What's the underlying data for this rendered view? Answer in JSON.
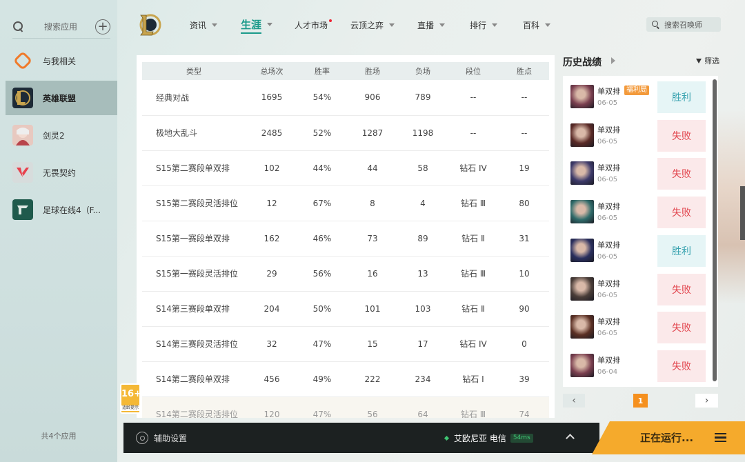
{
  "sidebar": {
    "search_label": "搜索应用",
    "items": [
      {
        "label": "与我相关",
        "icon": "related-icon"
      },
      {
        "label": "英雄联盟",
        "icon": "lol-icon"
      },
      {
        "label": "剑灵2",
        "icon": "bns2-icon"
      },
      {
        "label": "无畏契约",
        "icon": "valorant-icon"
      },
      {
        "label": "足球在线4（F...",
        "icon": "fo4-icon"
      }
    ],
    "active_index": 1,
    "footer": "共4个应用"
  },
  "nav": {
    "items": [
      "资讯",
      "生涯",
      "人才市场",
      "云顶之弈",
      "直播",
      "排行",
      "百科"
    ],
    "active_index": 1,
    "search_placeholder": "搜索召唤师"
  },
  "stats": {
    "headers": [
      "类型",
      "总场次",
      "胜率",
      "胜场",
      "负场",
      "段位",
      "胜点"
    ],
    "rows": [
      [
        "经典对战",
        "1695",
        "54%",
        "906",
        "789",
        "--",
        "--"
      ],
      [
        "极地大乱斗",
        "2485",
        "52%",
        "1287",
        "1198",
        "--",
        "--"
      ],
      [
        "S15第二赛段单双排",
        "102",
        "44%",
        "44",
        "58",
        "钻石 IV",
        "19"
      ],
      [
        "S15第二赛段灵活排位",
        "12",
        "67%",
        "8",
        "4",
        "钻石 Ⅲ",
        "80"
      ],
      [
        "S15第一赛段单双排",
        "162",
        "46%",
        "73",
        "89",
        "钻石 Ⅱ",
        "31"
      ],
      [
        "S15第一赛段灵活排位",
        "29",
        "56%",
        "16",
        "13",
        "钻石 Ⅲ",
        "10"
      ],
      [
        "S14第三赛段单双排",
        "204",
        "50%",
        "101",
        "103",
        "钻石 Ⅱ",
        "90"
      ],
      [
        "S14第三赛段灵活排位",
        "32",
        "47%",
        "15",
        "17",
        "钻石 IV",
        "0"
      ],
      [
        "S14第二赛段单双排",
        "456",
        "49%",
        "222",
        "234",
        "钻石 Ⅰ",
        "39"
      ],
      [
        "S14第二赛段灵活排位",
        "120",
        "47%",
        "56",
        "64",
        "钻石 Ⅲ",
        "74"
      ]
    ]
  },
  "history": {
    "title": "历史战绩",
    "filter": "筛选",
    "matches": [
      {
        "mode": "单双排",
        "tag": "福利局",
        "date": "06-05",
        "result": "胜利",
        "win": true,
        "color": "#7a3f4f"
      },
      {
        "mode": "单双排",
        "tag": "",
        "date": "06-05",
        "result": "失败",
        "win": false,
        "color": "#5a2a26"
      },
      {
        "mode": "单双排",
        "tag": "",
        "date": "06-05",
        "result": "失败",
        "win": false,
        "color": "#3d3a6a"
      },
      {
        "mode": "单双排",
        "tag": "",
        "date": "06-05",
        "result": "失败",
        "win": false,
        "color": "#2f6b6a"
      },
      {
        "mode": "单双排",
        "tag": "",
        "date": "06-05",
        "result": "胜利",
        "win": true,
        "color": "#2a2f5e"
      },
      {
        "mode": "单双排",
        "tag": "",
        "date": "06-05",
        "result": "失败",
        "win": false,
        "color": "#4a3d38"
      },
      {
        "mode": "单双排",
        "tag": "",
        "date": "06-05",
        "result": "失败",
        "win": false,
        "color": "#5b3024"
      },
      {
        "mode": "单双排",
        "tag": "",
        "date": "06-04",
        "result": "失败",
        "win": false,
        "color": "#7a3f4f"
      }
    ],
    "page": "1",
    "prev": "‹",
    "next": "›"
  },
  "rating": {
    "age": "16+",
    "label": "适龄提示"
  },
  "bottom": {
    "assist": "辅助设置",
    "server": "艾欧尼亚 电信",
    "ping": "54ms",
    "run": "正在运行..."
  },
  "colors": {
    "accent": "#1a9a8a",
    "win": "#3aa3b0",
    "lose": "#e2464f",
    "run": "#f5aa2c"
  }
}
